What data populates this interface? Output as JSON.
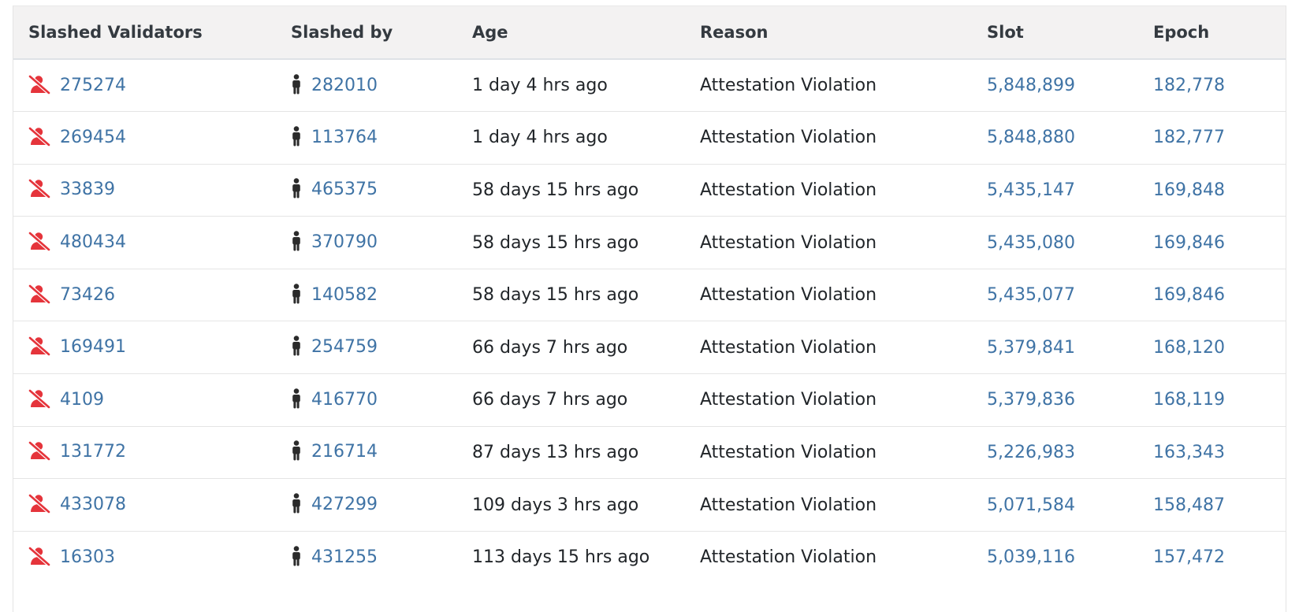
{
  "table": {
    "headers": {
      "validator": "Slashed Validators",
      "slashed_by": "Slashed by",
      "age": "Age",
      "reason": "Reason",
      "slot": "Slot",
      "epoch": "Epoch"
    },
    "icons": {
      "validator": "slashed-user-icon",
      "slashed_by": "person-icon"
    },
    "colors": {
      "link": "#3f73a5",
      "slashed_icon": "#e5343b",
      "header_bg": "#f3f2f2"
    },
    "rows": [
      {
        "validator": "275274",
        "slashed_by": "282010",
        "age": "1 day 4 hrs ago",
        "reason": "Attestation Violation",
        "slot": "5,848,899",
        "epoch": "182,778"
      },
      {
        "validator": "269454",
        "slashed_by": "113764",
        "age": "1 day 4 hrs ago",
        "reason": "Attestation Violation",
        "slot": "5,848,880",
        "epoch": "182,777"
      },
      {
        "validator": "33839",
        "slashed_by": "465375",
        "age": "58 days 15 hrs ago",
        "reason": "Attestation Violation",
        "slot": "5,435,147",
        "epoch": "169,848"
      },
      {
        "validator": "480434",
        "slashed_by": "370790",
        "age": "58 days 15 hrs ago",
        "reason": "Attestation Violation",
        "slot": "5,435,080",
        "epoch": "169,846"
      },
      {
        "validator": "73426",
        "slashed_by": "140582",
        "age": "58 days 15 hrs ago",
        "reason": "Attestation Violation",
        "slot": "5,435,077",
        "epoch": "169,846"
      },
      {
        "validator": "169491",
        "slashed_by": "254759",
        "age": "66 days 7 hrs ago",
        "reason": "Attestation Violation",
        "slot": "5,379,841",
        "epoch": "168,120"
      },
      {
        "validator": "4109",
        "slashed_by": "416770",
        "age": "66 days 7 hrs ago",
        "reason": "Attestation Violation",
        "slot": "5,379,836",
        "epoch": "168,119"
      },
      {
        "validator": "131772",
        "slashed_by": "216714",
        "age": "87 days 13 hrs ago",
        "reason": "Attestation Violation",
        "slot": "5,226,983",
        "epoch": "163,343"
      },
      {
        "validator": "433078",
        "slashed_by": "427299",
        "age": "109 days 3 hrs ago",
        "reason": "Attestation Violation",
        "slot": "5,071,584",
        "epoch": "158,487"
      },
      {
        "validator": "16303",
        "slashed_by": "431255",
        "age": "113 days 15 hrs ago",
        "reason": "Attestation Violation",
        "slot": "5,039,116",
        "epoch": "157,472"
      }
    ]
  }
}
